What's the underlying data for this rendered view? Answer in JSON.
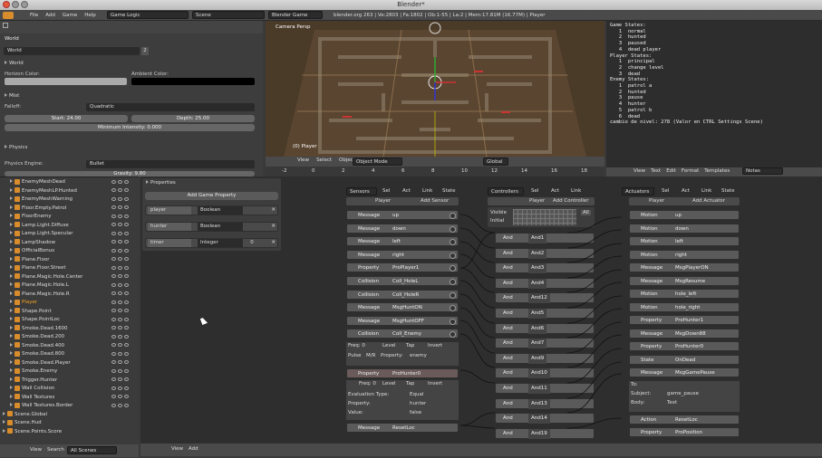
{
  "window": {
    "title": "Blender*"
  },
  "topbar": {
    "menus": [
      "File",
      "Add",
      "Game",
      "Help"
    ],
    "screen_layout": "Game Logic",
    "scene": "Scene",
    "engine": "Blender Game",
    "info": "blender.org 263 | Ve:2803 | Fa:1802 | Ob:1-55 | La:2 | Mem:17.81M (16.77M) | Player"
  },
  "properties": {
    "context": "World",
    "world_name": "World",
    "world_users": "2",
    "sections": {
      "world": "World",
      "mist": "Mist",
      "physics": "Physics"
    },
    "horizon_color_label": "Horizon Color:",
    "ambient_color_label": "Ambient Color:",
    "falloff_label": "Falloff:",
    "falloff_value": "Quadratic",
    "start_value": "Start: 24.00",
    "depth_value": "Depth: 25.00",
    "min_intensity": "Minimum Intensity: 0.000",
    "physics_engine_label": "Physics Engine:",
    "physics_engine_value": "Bullet",
    "gravity": "Gravity: 9.80"
  },
  "outliner": {
    "items": [
      "EnemyMeshDead",
      "EnemyMeshLP.Hunted",
      "EnemyMeshWarning",
      "Floor.Empty.Patrol",
      "FloorEnemy",
      "Lamp.Light.Diffuse",
      "Lamp.Light.Specular",
      "LampShadow",
      "OfficialBonus",
      "Plane.Floor",
      "Plane.Floor.Street",
      "Plane.Magic.Hole.Center",
      "Plane.Magic.Hole.L",
      "Plane.Magic.Hole.R",
      "Player",
      "Shape.Point",
      "Shape.PointLoc",
      "Smoke.Dead.1600",
      "Smoke.Dead.200",
      "Smoke.Dead.400",
      "Smoke.Dead.800",
      "Smoke.Dead.Player",
      "Smoke.Enemy",
      "Trigger.Hunter",
      "Wall Collision",
      "Wall Textures",
      "Wall Textures.Border",
      "Scene.Global",
      "Scene.Hud",
      "Scene.Points.Score"
    ],
    "view_label": "View",
    "search_label": "Search",
    "scenes_label": "All Scenes"
  },
  "viewport": {
    "camera_label": "Camera Persp",
    "object_label": "(0) Player",
    "menus": [
      "View",
      "Select",
      "Object"
    ],
    "mode": "Object Mode",
    "orientation": "Global",
    "timeline_ticks": [
      "-2",
      "0",
      "2",
      "4",
      "6",
      "8",
      "10",
      "12",
      "14",
      "16",
      "18"
    ]
  },
  "text_editor": {
    "lines": [
      "Game States:",
      "   1  normal",
      "   2  hunted",
      "   3  paused",
      "   4  dead player",
      "",
      "Player States:",
      "   1  principal",
      "   2  change level",
      "   3  dead",
      "",
      "Enemy States:",
      "   1  patrol a",
      "   2  hunted",
      "   3  pause",
      "   4  hunter",
      "   5  patrol b",
      "   6  dead",
      "",
      "cambio de nivel: 278 (Valor en CTRL Settings Scene)"
    ],
    "menus": [
      "View",
      "Text",
      "Edit",
      "Format",
      "Templates"
    ],
    "file": "Notas"
  },
  "game_properties": {
    "title": "Properties",
    "add_button": "Add Game Property",
    "rows": [
      {
        "name": "player",
        "type": "Boolean",
        "value": ""
      },
      {
        "name": "hunter",
        "type": "Boolean",
        "value": ""
      },
      {
        "name": "timer",
        "type": "Integer",
        "value": "0"
      }
    ]
  },
  "logic": {
    "sensors_label": "Sensors",
    "controllers_label": "Controllers",
    "actuators_label": "Actuators",
    "sel": "Sel",
    "act": "Act",
    "link": "Link",
    "state": "State",
    "object_name": "Player",
    "add_sensor": "Add Sensor",
    "add_controller": "Add Controller",
    "add_actuator": "Add Actuator",
    "visible_label": "Visible",
    "initial_label": "Initial",
    "all_label": "All",
    "sensors": [
      {
        "type": "Message",
        "name": "up"
      },
      {
        "type": "Message",
        "name": "down"
      },
      {
        "type": "Message",
        "name": "left"
      },
      {
        "type": "Message",
        "name": "right"
      },
      {
        "type": "Property",
        "name": "ProPlayer1"
      },
      {
        "type": "Collision",
        "name": "Coll_HoleL"
      },
      {
        "type": "Collision",
        "name": "Coll_HoleR"
      },
      {
        "type": "Message",
        "name": "MsgHuntON"
      },
      {
        "type": "Message",
        "name": "MsgHuntOFF"
      },
      {
        "type": "Collision",
        "name": "Coll_Enemy"
      }
    ],
    "coll_enemy_detail": {
      "freq": "Freq: 0",
      "level": "Level",
      "tap": "Tap",
      "invert": "Invert",
      "pulse": "Pulse",
      "mr": "M/R",
      "property_label": "Property:",
      "property_value": "enemy"
    },
    "property_sensor": {
      "type": "Property",
      "name": "ProHunter0",
      "freq": "Freq: 0",
      "level": "Level",
      "tap": "Tap",
      "invert": "Invert",
      "evaluation_label": "Evaluation Type:",
      "evaluation_value": "Equal",
      "property_label": "Property:",
      "property_value": "hunter",
      "value_label": "Value:",
      "value_value": "false"
    },
    "last_sensor": {
      "type": "Message",
      "name": "ResetLoc"
    },
    "controllers": [
      {
        "type": "And",
        "name": "And1"
      },
      {
        "type": "And",
        "name": "And2"
      },
      {
        "type": "And",
        "name": "And3"
      },
      {
        "type": "And",
        "name": "And4"
      },
      {
        "type": "And",
        "name": "And12"
      },
      {
        "type": "And",
        "name": "And5"
      },
      {
        "type": "And",
        "name": "And6"
      },
      {
        "type": "And",
        "name": "And7"
      },
      {
        "type": "And",
        "name": "And9"
      },
      {
        "type": "And",
        "name": "And10"
      },
      {
        "type": "And",
        "name": "And11"
      },
      {
        "type": "And",
        "name": "And13"
      },
      {
        "type": "And",
        "name": "And14"
      },
      {
        "type": "And",
        "name": "And19"
      },
      {
        "type": "And",
        "name": "And15"
      }
    ],
    "actuators": [
      {
        "type": "Motion",
        "name": "up"
      },
      {
        "type": "Motion",
        "name": "down"
      },
      {
        "type": "Motion",
        "name": "left"
      },
      {
        "type": "Motion",
        "name": "right"
      },
      {
        "type": "Message",
        "name": "MsgPlayerON"
      },
      {
        "type": "Message",
        "name": "MsgResume"
      },
      {
        "type": "Motion",
        "name": "hole_left"
      },
      {
        "type": "Motion",
        "name": "hole_right"
      },
      {
        "type": "Property",
        "name": "ProHunter1"
      },
      {
        "type": "Message",
        "name": "MsgDown88"
      },
      {
        "type": "Property",
        "name": "ProHunter0"
      },
      {
        "type": "State",
        "name": "OnDead"
      },
      {
        "type": "Message",
        "name": "MsgGamePause"
      }
    ],
    "msg_detail": {
      "to_label": "To:",
      "subject_label": "Subject:",
      "subject_value": "game_pause",
      "body_label": "Body:",
      "body_value": "Text"
    },
    "last_actuators": [
      {
        "type": "Action",
        "name": "ResetLoc"
      },
      {
        "type": "Property",
        "name": "ProPosition"
      }
    ]
  },
  "bottom": {
    "view": "View",
    "add": "Add"
  }
}
